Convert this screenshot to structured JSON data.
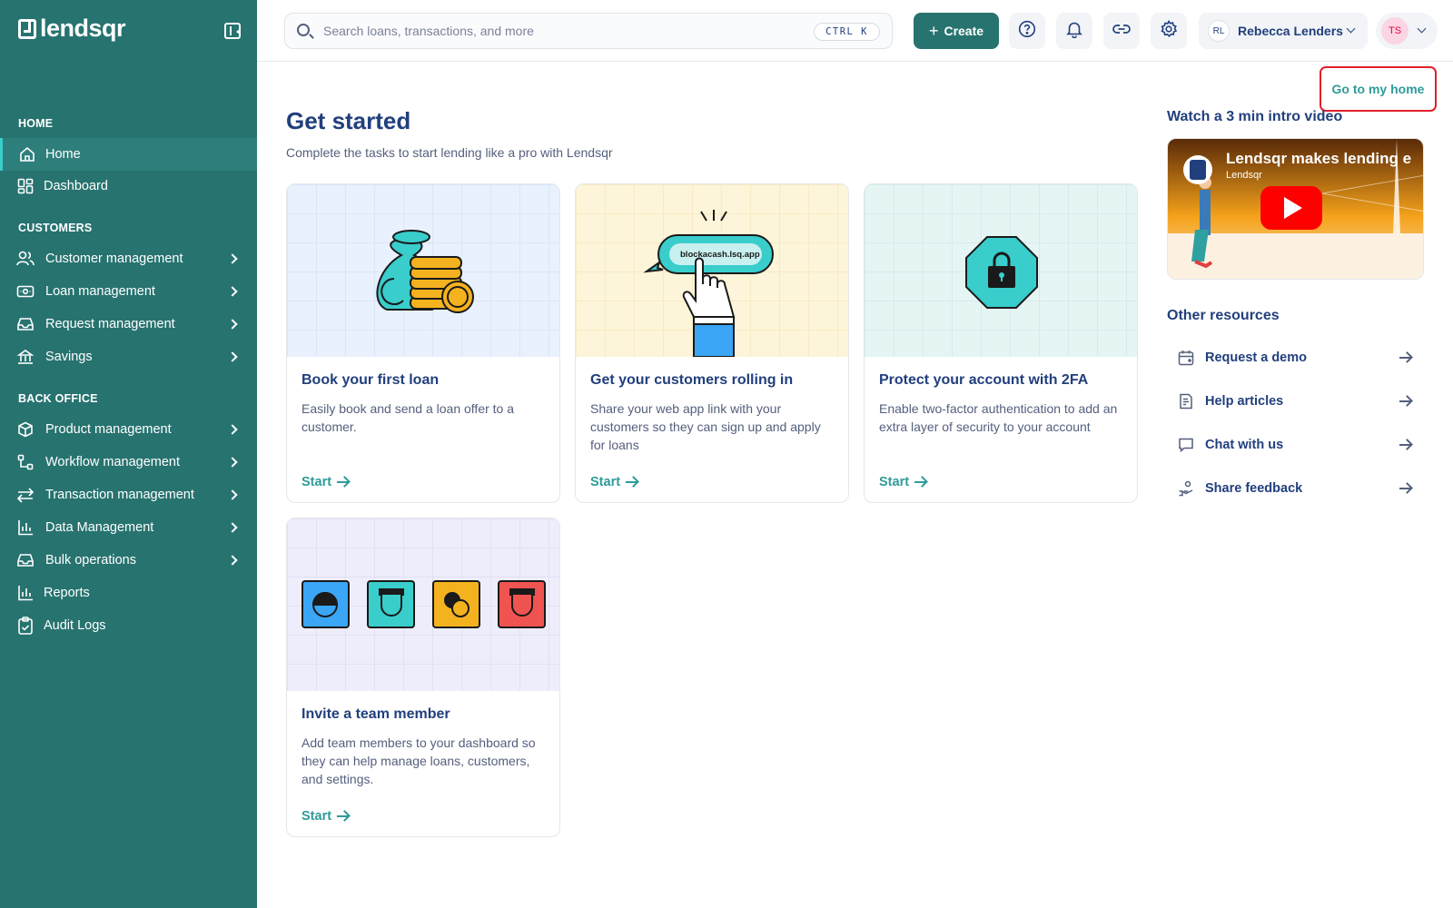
{
  "brand": {
    "name": "lendsqr"
  },
  "sidebar": {
    "sections": {
      "home": "HOME",
      "customers": "CUSTOMERS",
      "back_office": "BACK OFFICE"
    },
    "home_items": [
      {
        "label": "Home",
        "icon": "home-icon",
        "active": true
      },
      {
        "label": "Dashboard",
        "icon": "dashboard-icon"
      }
    ],
    "customer_items": [
      {
        "label": "Customer management",
        "icon": "users-icon"
      },
      {
        "label": "Loan management",
        "icon": "money-icon"
      },
      {
        "label": "Request management",
        "icon": "inbox-icon"
      },
      {
        "label": "Savings",
        "icon": "savings-icon"
      }
    ],
    "backoffice_items": [
      {
        "label": "Product management",
        "icon": "box-icon"
      },
      {
        "label": "Workflow management",
        "icon": "workflow-icon"
      },
      {
        "label": "Transaction management",
        "icon": "transfer-icon"
      },
      {
        "label": "Data Management",
        "icon": "bar-chart-icon"
      },
      {
        "label": "Bulk operations",
        "icon": "inbox-icon"
      },
      {
        "label": "Reports",
        "icon": "bar-chart-icon"
      },
      {
        "label": "Audit Logs",
        "icon": "clipboard-icon"
      }
    ]
  },
  "topbar": {
    "search_placeholder": "Search loans, transactions, and more",
    "shortcut": "CTRL K",
    "create_label": "Create",
    "user_initials": "RL",
    "user_name": "Rebecca Lenders",
    "profile_initials": "TS"
  },
  "main": {
    "home_link": "Go to my home",
    "title": "Get started",
    "subtitle": "Complete the tasks to start lending like a pro with Lendsqr",
    "cards": [
      {
        "title": "Book your first loan",
        "desc": "Easily book and send a loan offer to a customer.",
        "cta": "Start",
        "bg": "#e8f1fd"
      },
      {
        "title": "Get your customers rolling in",
        "desc": "Share your web app link with your customers so they can sign up and apply for loans",
        "cta": "Start",
        "bg": "#fdf5d9",
        "url": "blockacash.lsq.app"
      },
      {
        "title": "Protect your account with 2FA",
        "desc": "Enable two-factor authentication to add an extra layer of security to your account",
        "cta": "Start",
        "bg": "#e5f5f4"
      },
      {
        "title": "Invite a team member",
        "desc": "Add team members to your dashboard so they can help manage loans, customers, and settings.",
        "cta": "Start",
        "bg": "#eeedfb"
      }
    ]
  },
  "video": {
    "heading": "Watch a 3 min intro video",
    "title": "Lendsqr makes lending e",
    "channel": "Lendsqr"
  },
  "resources": {
    "heading": "Other resources",
    "items": [
      {
        "label": "Request a demo",
        "icon": "calendar-icon"
      },
      {
        "label": "Help articles",
        "icon": "document-icon"
      },
      {
        "label": "Chat with us",
        "icon": "chat-icon"
      },
      {
        "label": "Share feedback",
        "icon": "feedback-icon"
      }
    ]
  },
  "colors": {
    "sidebar": "#277370",
    "accent": "#2f9b99",
    "text": "#213f7d",
    "highlight": "#e0202a"
  }
}
